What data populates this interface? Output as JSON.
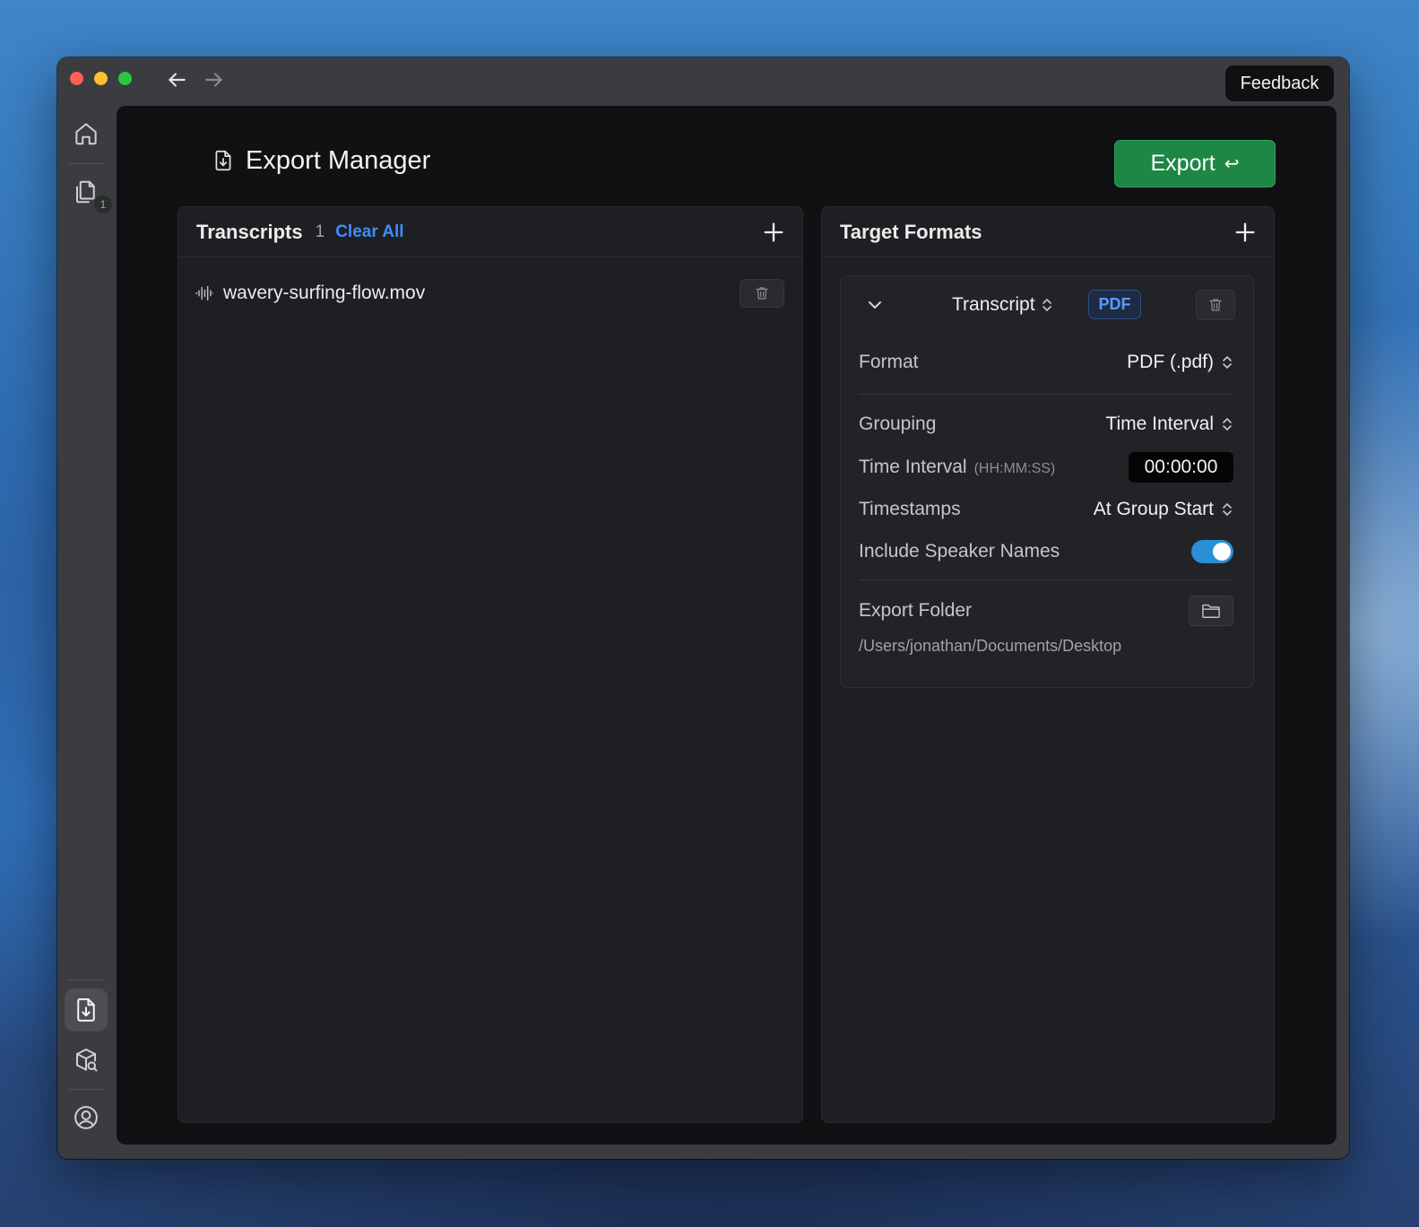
{
  "window": {
    "feedback_label": "Feedback"
  },
  "sidebar": {
    "items": [
      {
        "name": "home",
        "icon": "home-icon"
      },
      {
        "name": "transcripts",
        "icon": "files-icon",
        "badge": "1"
      },
      {
        "name": "export-manager",
        "icon": "export-icon",
        "active": true
      },
      {
        "name": "models",
        "icon": "package-search-icon"
      },
      {
        "name": "account",
        "icon": "user-circle-icon"
      }
    ]
  },
  "header": {
    "title": "Export Manager",
    "export_label": "Export",
    "export_shortcut": "↩"
  },
  "transcripts": {
    "title": "Transcripts",
    "count": "1",
    "clear_all": "Clear All",
    "files": [
      {
        "name": "wavery-surfing-flow.mov",
        "icon": "waveform-icon"
      }
    ]
  },
  "targets": {
    "title": "Target Formats",
    "cards": [
      {
        "template": "Transcript",
        "badge": "PDF",
        "format_label": "Format",
        "format_value": "PDF (.pdf)",
        "grouping_label": "Grouping",
        "grouping_value": "Time Interval",
        "interval_label": "Time Interval",
        "interval_hint": "(HH:MM:SS)",
        "interval_value": "00:00:00",
        "timestamps_label": "Timestamps",
        "timestamps_value": "At Group Start",
        "speaker_label": "Include Speaker Names",
        "speaker_enabled": true,
        "folder_label": "Export Folder",
        "folder_path": "/Users/jonathan/Documents/Desktop"
      }
    ]
  },
  "colors": {
    "accent_blue": "#3f8cff",
    "export_green": "#1e8745",
    "toggle_on": "#2a8fd6"
  }
}
